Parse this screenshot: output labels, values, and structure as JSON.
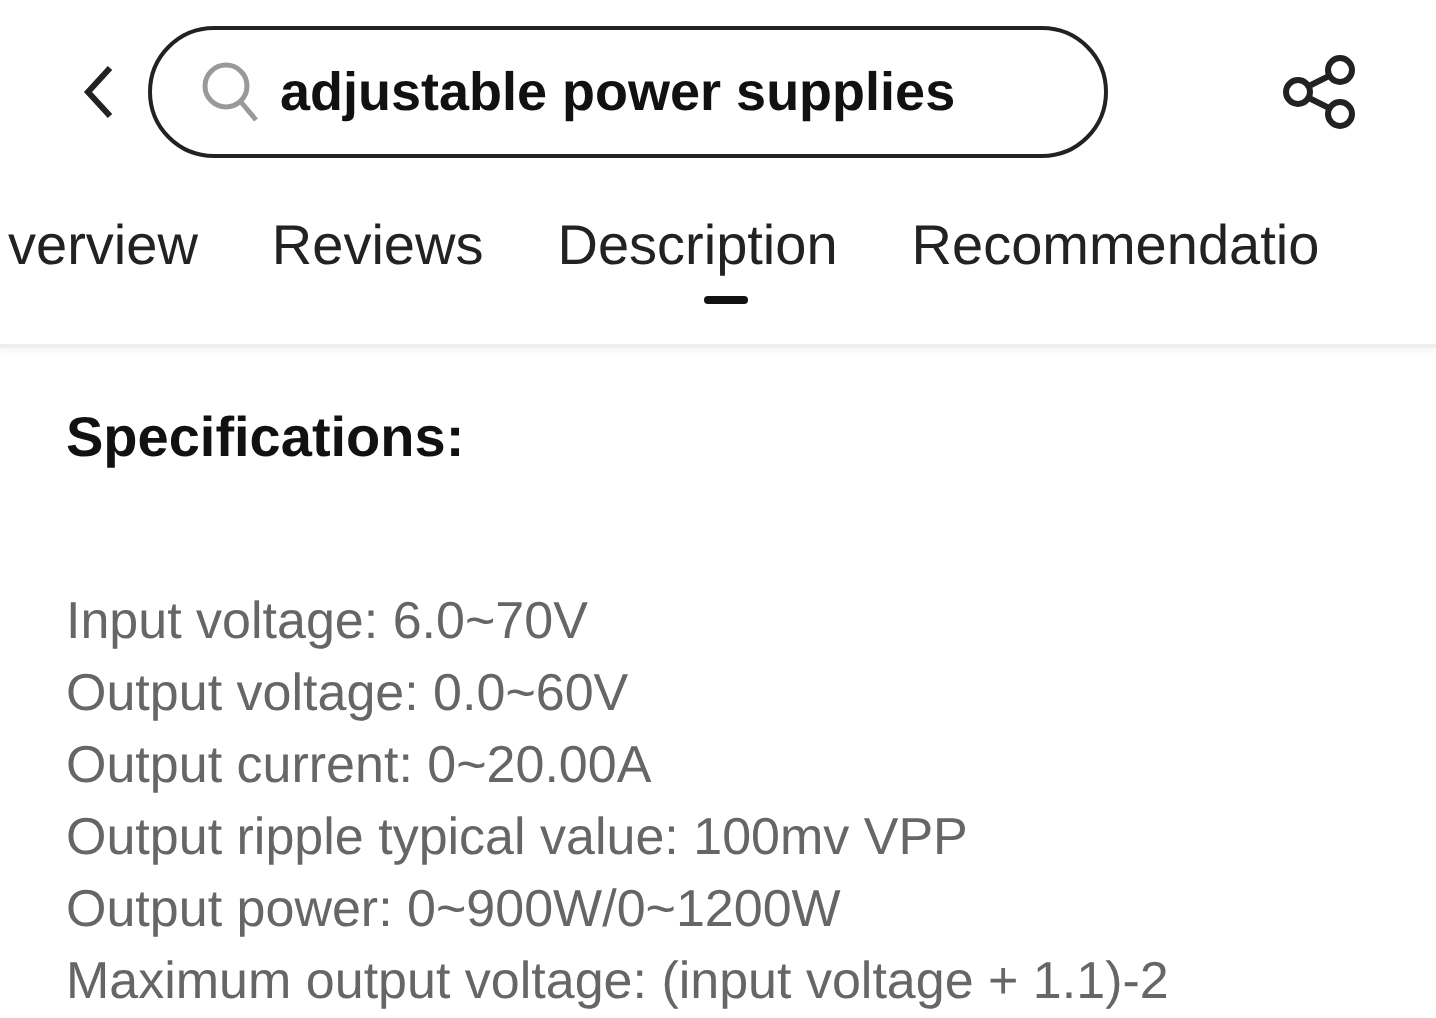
{
  "search": {
    "value": "adjustable power supplies"
  },
  "tabs": [
    {
      "label": "verview",
      "selected": false
    },
    {
      "label": "Reviews",
      "selected": false
    },
    {
      "label": "Description",
      "selected": true
    },
    {
      "label": "Recommendatio",
      "selected": false
    }
  ],
  "section": {
    "title": "Specifications:",
    "lines": [
      "Input voltage: 6.0~70V",
      "Output voltage: 0.0~60V",
      "Output current: 0~20.00A",
      "Output ripple typical value: 100mv VPP",
      "Output power: 0~900W/0~1200W",
      "Maximum output voltage: (input voltage + 1.1)-2"
    ]
  }
}
